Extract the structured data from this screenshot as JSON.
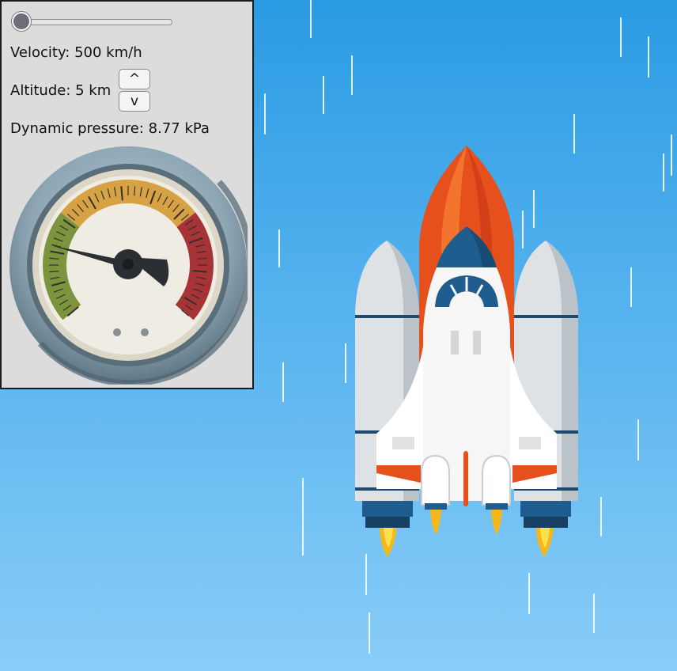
{
  "window": {
    "velocity_label": "Velocity: 500 km/h",
    "altitude_label": "Altitude: 5 km",
    "pressure_label": "Dynamic pressure: 8.77 kPa",
    "altitude_up_glyph": "^",
    "altitude_down_glyph": "v"
  },
  "velocity_slider": {
    "level_fraction": 0.0
  },
  "gauge": {
    "zones": [
      "green",
      "yellow",
      "red"
    ],
    "needle": "pressure reading"
  },
  "colors": {
    "sky_top": "#2a9be3",
    "sky_bottom": "#89cdf8",
    "gauge_green": "#7d943f",
    "gauge_yellow": "#d7a244",
    "gauge_red": "#a63335",
    "rocket_orange": "#e5501c",
    "rocket_navy": "#1f5d8e"
  },
  "icons": {
    "slider_knob": "slider-knob",
    "spin_up": "chevron-up-icon",
    "spin_down": "chevron-down-icon",
    "gauge": "pressure-gauge-icon",
    "rocket": "space-shuttle-illustration"
  }
}
